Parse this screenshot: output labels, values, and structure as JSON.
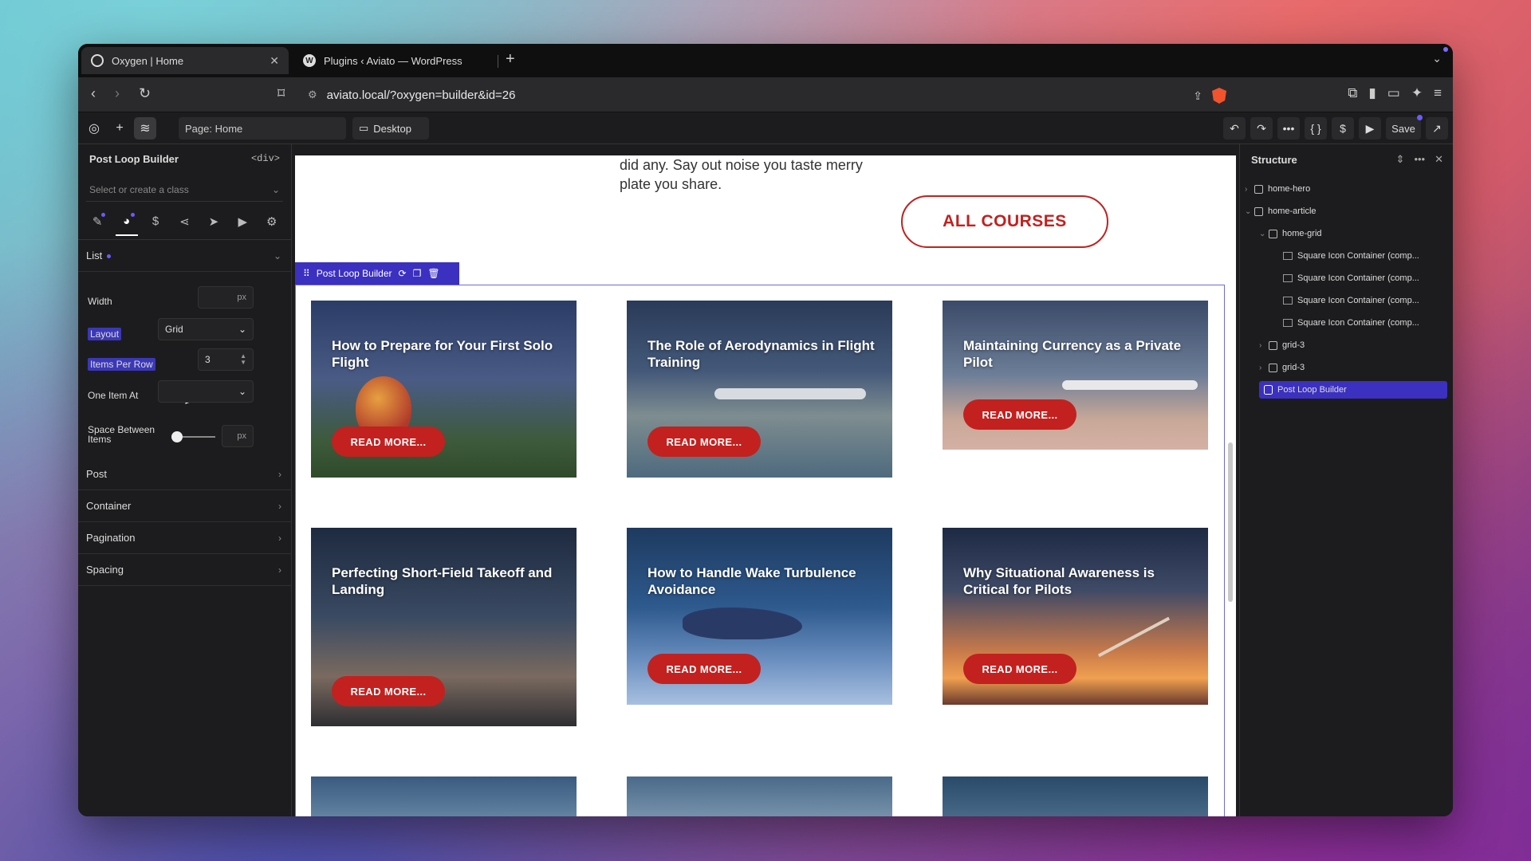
{
  "browser": {
    "tabs": [
      {
        "title": "Oxygen | Home",
        "active": true
      },
      {
        "title": "Plugins ‹ Aviato — WordPress",
        "active": false
      }
    ],
    "url": "aviato.local/?oxygen=builder&id=26"
  },
  "toolbar": {
    "page_label": "Page: Home",
    "device_label": "Desktop",
    "save_label": "Save"
  },
  "left_panel": {
    "title": "Post Loop Builder",
    "tag": "<div>",
    "class_placeholder": "Select or create a class",
    "list_label": "List",
    "width_label": "Width",
    "width_unit": "px",
    "layout_label": "Layout",
    "layout_value": "Grid",
    "items_per_row_label": "Items Per Row",
    "items_per_row_value": "3",
    "one_item_at_label": "One Item At",
    "space_between_label": "Space Between Items",
    "space_unit": "px",
    "space_between_level": 0,
    "sections": [
      "Post",
      "Container",
      "Pagination",
      "Spacing"
    ]
  },
  "canvas": {
    "intro_text_line1": "did any. Say out noise you taste merry",
    "intro_text_line2": "plate you share.",
    "all_courses_label": "ALL COURSES",
    "plb_label": "Post Loop Builder",
    "cards": [
      {
        "title": "How to Prepare for Your First Solo Flight",
        "button": "READ MORE..."
      },
      {
        "title": "The Role of Aerodynamics in Flight Training",
        "button": "READ MORE..."
      },
      {
        "title": "Maintaining Currency as a Private Pilot",
        "button": "READ MORE..."
      },
      {
        "title": "Perfecting Short-Field Takeoff and Landing",
        "button": "READ MORE..."
      },
      {
        "title": "How to Handle Wake Turbulence Avoidance",
        "button": "READ MORE..."
      },
      {
        "title": "Why Situational Awareness is Critical for Pilots",
        "button": "READ MORE..."
      }
    ]
  },
  "structure": {
    "title": "Structure",
    "items": [
      {
        "label": "home-hero"
      },
      {
        "label": "home-article"
      },
      {
        "label": "home-grid"
      },
      {
        "label": "Square Icon Container (comp..."
      },
      {
        "label": "Square Icon Container (comp..."
      },
      {
        "label": "Square Icon Container (comp..."
      },
      {
        "label": "Square Icon Container (comp..."
      },
      {
        "label": "grid-3"
      },
      {
        "label": "grid-3"
      },
      {
        "label": "Post Loop Builder"
      }
    ]
  },
  "colors": {
    "accent": "#3b30c0",
    "brand_red": "#c2211f"
  }
}
